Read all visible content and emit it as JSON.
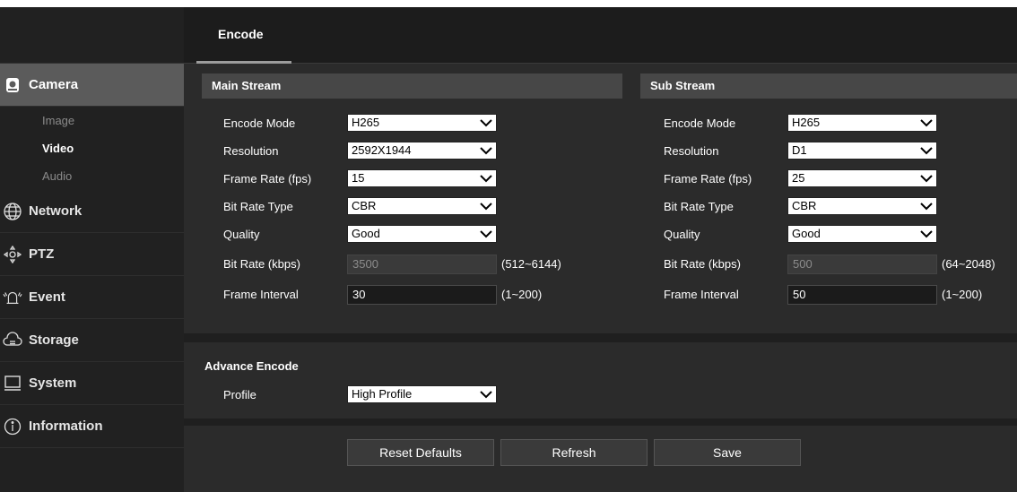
{
  "sidebar": {
    "items": [
      {
        "label": "Camera",
        "icon": "camera-icon"
      },
      {
        "label": "Network",
        "icon": "network-icon"
      },
      {
        "label": "PTZ",
        "icon": "ptz-icon"
      },
      {
        "label": "Event",
        "icon": "event-icon"
      },
      {
        "label": "Storage",
        "icon": "storage-icon"
      },
      {
        "label": "System",
        "icon": "system-icon"
      },
      {
        "label": "Information",
        "icon": "info-icon"
      }
    ],
    "camera_sub": [
      "Image",
      "Video",
      "Audio"
    ],
    "active_sub": "Video"
  },
  "tab": {
    "label": "Encode"
  },
  "main_stream": {
    "title": "Main Stream",
    "labels": {
      "encode_mode": "Encode Mode",
      "resolution": "Resolution",
      "frame_rate": "Frame Rate (fps)",
      "bit_rate_type": "Bit Rate Type",
      "quality": "Quality",
      "bit_rate": "Bit Rate (kbps)",
      "frame_interval": "Frame Interval"
    },
    "values": {
      "encode_mode": "H265",
      "resolution": "2592X1944",
      "frame_rate": "15",
      "bit_rate_type": "CBR",
      "quality": "Good",
      "bit_rate": "3500",
      "frame_interval": "30"
    },
    "ranges": {
      "bit_rate": "(512~6144)",
      "frame_interval": "(1~200)"
    }
  },
  "sub_stream": {
    "title": "Sub Stream",
    "labels": {
      "encode_mode": "Encode Mode",
      "resolution": "Resolution",
      "frame_rate": "Frame Rate (fps)",
      "bit_rate_type": "Bit Rate Type",
      "quality": "Quality",
      "bit_rate": "Bit Rate (kbps)",
      "frame_interval": "Frame Interval"
    },
    "values": {
      "encode_mode": "H265",
      "resolution": "D1",
      "frame_rate": "25",
      "bit_rate_type": "CBR",
      "quality": "Good",
      "bit_rate": "500",
      "frame_interval": "50"
    },
    "ranges": {
      "bit_rate": "(64~2048)",
      "frame_interval": "(1~200)"
    }
  },
  "advance": {
    "title": "Advance Encode",
    "profile_label": "Profile",
    "profile_value": "High Profile"
  },
  "buttons": {
    "reset": "Reset Defaults",
    "refresh": "Refresh",
    "save": "Save"
  },
  "colors": {
    "sidebar_bg": "#212121",
    "active_item": "#5b5b5b",
    "content_bg": "#2b2b2b",
    "section_header": "#474747"
  }
}
